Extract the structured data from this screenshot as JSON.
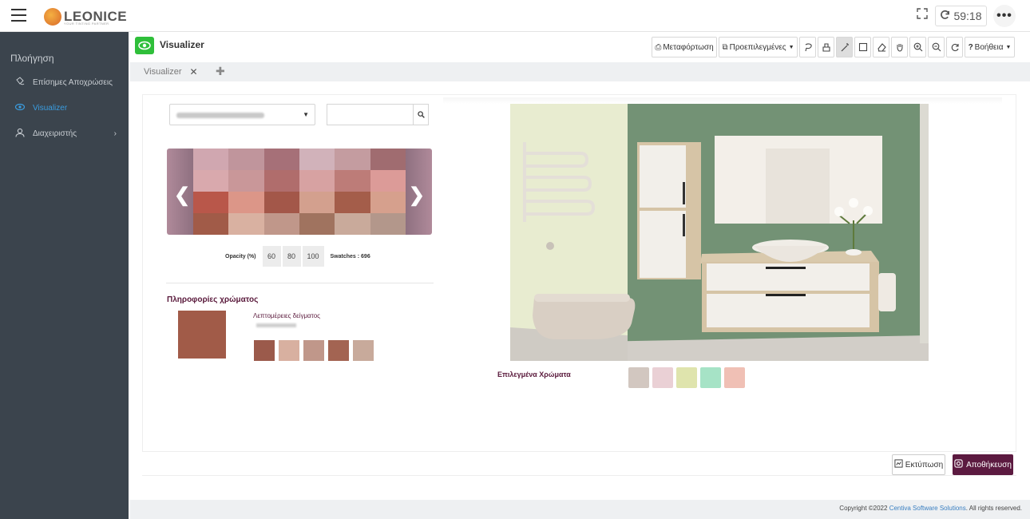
{
  "header": {
    "logo_text": "LEONICE",
    "logo_tagline": "YOUR TINTING PARTNER",
    "timer": "59:18"
  },
  "sidebar": {
    "heading": "Πλοήγηση",
    "items": [
      {
        "label": "Επίσημες Αποχρώσεις",
        "icon": "palette-icon"
      },
      {
        "label": "Visualizer",
        "icon": "eye-icon",
        "active": true
      },
      {
        "label": "Διαχειριστής",
        "icon": "user-icon"
      }
    ]
  },
  "page": {
    "title": "Visualizer",
    "tab_label": "Visualizer"
  },
  "toolbar": {
    "upload_label": "Μεταφόρτωση",
    "presets_label": "Προεπιλεγμένες",
    "help_label": "Βοήθεια"
  },
  "search": {
    "value": "",
    "placeholder": ""
  },
  "swatches": {
    "colors": [
      "#d0a7b0",
      "#c0959c",
      "#a67078",
      "#d1b2ba",
      "#c49ca0",
      "#a06c70",
      "#d9a9ad",
      "#c99799",
      "#b06d6c",
      "#d7a2a2",
      "#bd7c78",
      "#dc9b98",
      "#b9574a",
      "#dc9688",
      "#a35749",
      "#d3a08e",
      "#a45d4a",
      "#d6a08d",
      "#a15b48",
      "#d9b1a1",
      "#c0978a",
      "#a0735f",
      "#c9aa9b",
      "#b3978b"
    ],
    "opacity_label": "Opacity (%)",
    "opacity_options": [
      "60",
      "80",
      "100"
    ],
    "count_label": "Swatches : 696"
  },
  "color_info": {
    "title": "Πληροφορίες χρώματος",
    "main_color": "#a15b48",
    "detail_label": "Λεπτομέρειες δείγματος",
    "related": [
      "#9b5a4b",
      "#d8b0a0",
      "#c0978a",
      "#a36452",
      "#c8aa9b"
    ]
  },
  "selected": {
    "title": "Επιλεγμένα Χρώματα",
    "colors": [
      "#d2c7c0",
      "#ead0d5",
      "#dfe4ad",
      "#a6e3c6",
      "#f0c0b5"
    ]
  },
  "actions": {
    "print_label": "Εκτύπωση",
    "save_label": "Αποθήκευση"
  },
  "footer": {
    "prefix": "Copyright ©2022",
    "company": "Centiva Software Solutions",
    "suffix": ". All rights reserved."
  }
}
